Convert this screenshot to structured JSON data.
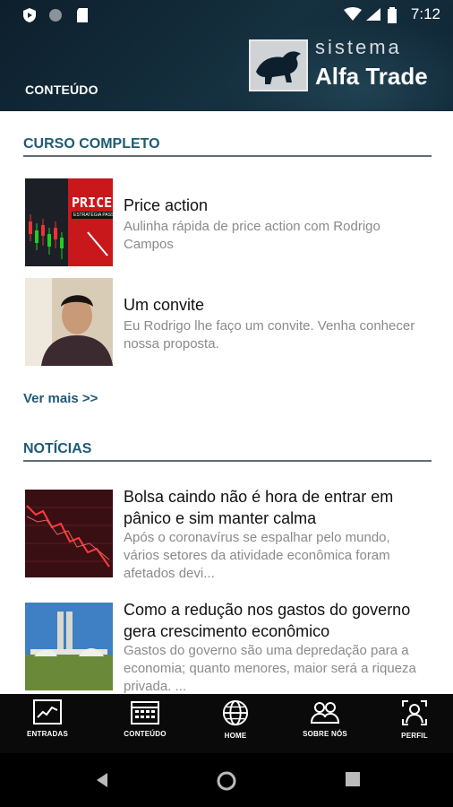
{
  "status_bar": {
    "time": "7:12",
    "left_icons": [
      "shield-play-icon",
      "circle-icon",
      "sd-card-icon"
    ],
    "right_icons": [
      "wifi-icon",
      "signal-icon",
      "battery-icon"
    ]
  },
  "header": {
    "section": "CONTEÚDO",
    "logo_small": "sistema",
    "logo_big": "Alfa Trade"
  },
  "curso": {
    "title": "CURSO COMPLETO",
    "items": [
      {
        "title": "Price action",
        "description": "Aulinha rápida de price action com Rodrigo Campos",
        "thumb_text": "PRICE A",
        "thumb_sub": "ESTRATÉGIA PASSO A PASSO"
      },
      {
        "title": "Um convite",
        "description": "Eu Rodrigo lhe faço um convite. Venha conhecer nossa proposta."
      }
    ],
    "more": "Ver mais >>"
  },
  "noticias": {
    "title": "NOTÍCIAS",
    "items": [
      {
        "title": "Bolsa caindo não é hora de entrar em pânico e sim manter calma",
        "description": "Após o coronavírus se espalhar pelo mundo, vários setores da atividade econômica foram afetados devi..."
      },
      {
        "title": "Como a redução nos gastos do governo gera crescimento econômico",
        "description": "Gastos do governo são uma depredação para a economia; quanto menores, maior será a riqueza privada. ..."
      }
    ]
  },
  "bottom_nav": [
    {
      "label": "ENTRADAS",
      "icon": "chart-icon"
    },
    {
      "label": "CONTEÚDO",
      "icon": "calendar-icon"
    },
    {
      "label": "HOME",
      "icon": "globe-icon"
    },
    {
      "label": "SOBRE NÓS",
      "icon": "people-icon"
    },
    {
      "label": "PERFIL",
      "icon": "profile-icon"
    }
  ],
  "colors": {
    "header_bg": "#15303f",
    "section_title": "#1e5a75",
    "nav_bg": "#0a0a0a"
  }
}
